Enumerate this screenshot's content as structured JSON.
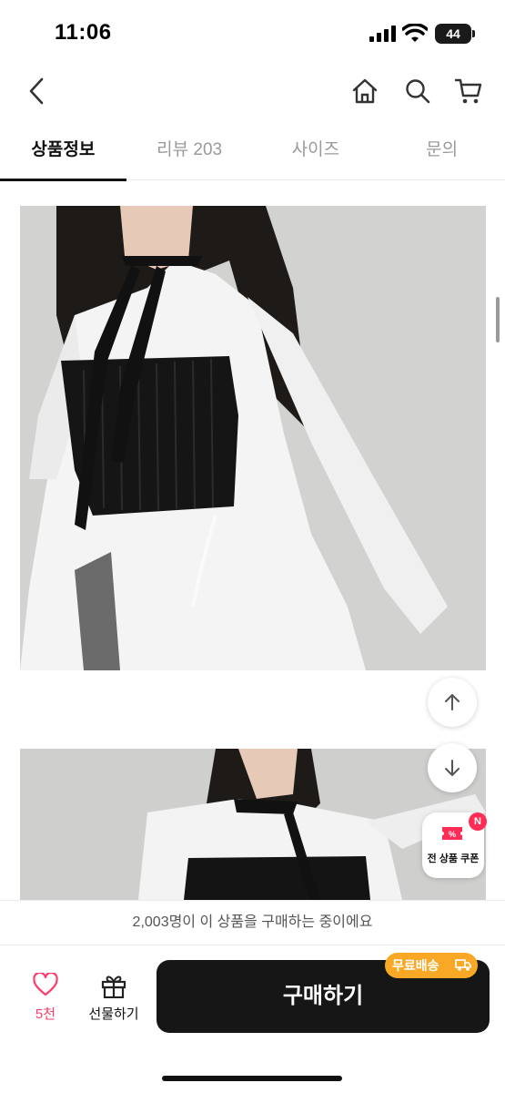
{
  "status_bar": {
    "time": "11:06",
    "battery": "44"
  },
  "header": {
    "back_icon": "chevron-left-icon",
    "home_icon": "home-icon",
    "search_icon": "search-icon",
    "cart_icon": "cart-icon"
  },
  "tabs": [
    {
      "label": "상품정보",
      "active": true
    },
    {
      "label": "리뷰 203",
      "active": false
    },
    {
      "label": "사이즈",
      "active": false
    },
    {
      "label": "문의",
      "active": false
    }
  ],
  "floating": {
    "up_icon": "arrow-up-icon",
    "down_icon": "arrow-down-icon",
    "coupon_label": "전 상품 쿠폰",
    "new_badge": "N"
  },
  "notice": {
    "text": "2,003명이 이 상품을 구매하는 중이에요"
  },
  "action_bar": {
    "like_count": "5천",
    "gift_label": "선물하기",
    "buy_label": "구매하기",
    "free_shipping_label": "무료배송"
  },
  "colors": {
    "accent_pink": "#ff3b6b",
    "badge_red": "#ff2d55",
    "shipping_orange": "#f9a825",
    "buy_button": "#161616"
  }
}
